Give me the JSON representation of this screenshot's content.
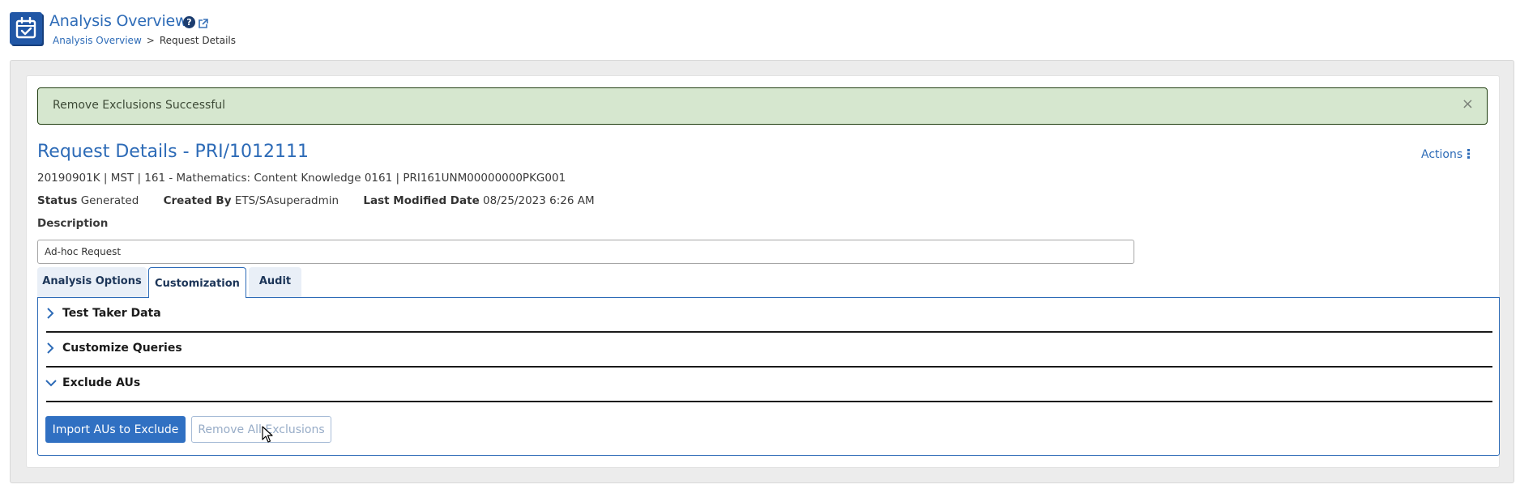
{
  "header": {
    "title": "Analysis Overview",
    "icons": {
      "app": "calendar-check-icon",
      "help": "question-circle-icon",
      "external": "external-link-icon"
    },
    "breadcrumb": [
      {
        "label": "Analysis Overview",
        "link": true
      },
      {
        "label": "Request Details",
        "link": false
      }
    ],
    "breadcrumb_separator": ">"
  },
  "alert": {
    "message": "Remove Exclusions Successful",
    "close_label": "×",
    "type": "success",
    "bg_color": "#d6e7cf"
  },
  "request": {
    "title": "Request Details - PRI/1012111",
    "actions_label": "Actions",
    "meta": "20190901K | MST | 161 - Mathematics: Content Knowledge 0161 | PRI161UNM00000000PKG001",
    "status_label": "Status",
    "status_value": "Generated",
    "created_by_label": "Created By",
    "created_by_value": "ETS/SAsuperadmin",
    "last_modified_label": "Last Modified Date",
    "last_modified_value": "08/25/2023 6:26 AM",
    "description_label": "Description",
    "description_value": "Ad-hoc Request"
  },
  "tabs": [
    {
      "label": "Analysis Options",
      "active": false
    },
    {
      "label": "Customization",
      "active": true
    },
    {
      "label": "Audit",
      "active": false
    }
  ],
  "accordion": [
    {
      "label": "Test Taker Data",
      "expanded": false
    },
    {
      "label": "Customize Queries",
      "expanded": false
    },
    {
      "label": "Exclude AUs",
      "expanded": true
    }
  ],
  "exclude_aus": {
    "import_button": "Import AUs to Exclude",
    "remove_all_button": "Remove All Exclusions",
    "remove_all_disabled": true
  },
  "colors": {
    "accent": "#2d6bb7",
    "primary_button": "#3070c2",
    "tab_inactive_bg": "#e9eff7"
  }
}
